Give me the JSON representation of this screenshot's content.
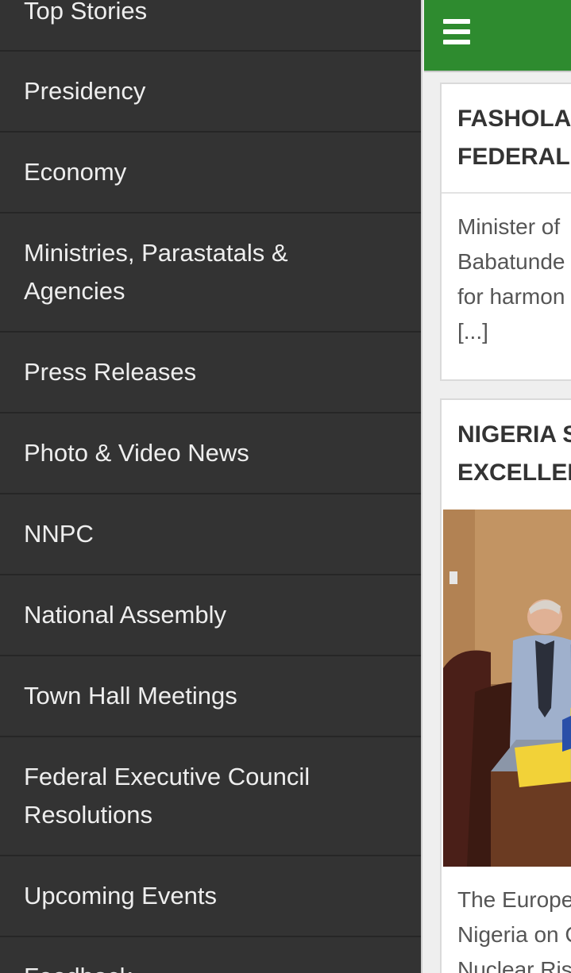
{
  "sidebar": {
    "items": [
      {
        "lines": [
          "Top Stories"
        ]
      },
      {
        "lines": [
          "Presidency"
        ]
      },
      {
        "lines": [
          "Economy"
        ]
      },
      {
        "lines": [
          "Ministries, Parastatals &",
          "Agencies"
        ]
      },
      {
        "lines": [
          "Press Releases"
        ]
      },
      {
        "lines": [
          "Photo & Video News"
        ]
      },
      {
        "lines": [
          "NNPC"
        ]
      },
      {
        "lines": [
          "National Assembly"
        ]
      },
      {
        "lines": [
          "Town Hall Meetings"
        ]
      },
      {
        "lines": [
          "Federal Executive Council",
          "Resolutions"
        ]
      },
      {
        "lines": [
          "Upcoming Events"
        ]
      },
      {
        "lines": [
          "Feedback"
        ]
      }
    ]
  },
  "header": {
    "menu_icon": "menu-icon",
    "accent": "#2e8b2f"
  },
  "articles": [
    {
      "title_lines": [
        "FASHOLA",
        "FEDERAL I"
      ],
      "excerpt_lines": [
        "Minister of",
        "Babatunde",
        "for harmon",
        "[...]"
      ]
    },
    {
      "title_lines": [
        "NIGERIA S",
        "EXCELLEN"
      ],
      "excerpt_lines": [
        "The Europe",
        "Nigeria on C",
        "Nuclear Ris"
      ]
    }
  ]
}
